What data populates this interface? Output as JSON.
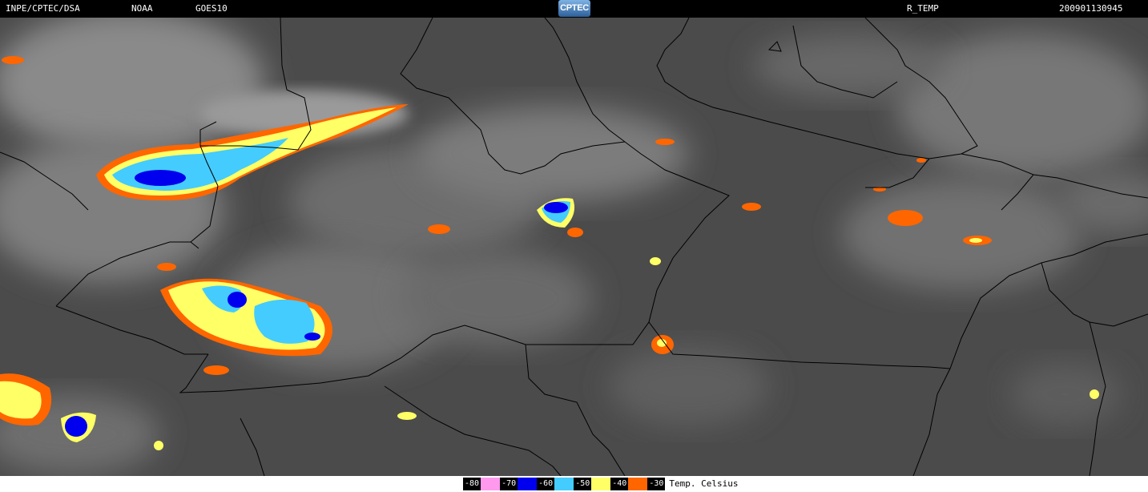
{
  "header": {
    "source": "INPE/CPTEC/DSA",
    "agency": "NOAA",
    "satellite": "GOES10",
    "logo_text": "CPTEC",
    "product": "R_TEMP",
    "timestamp": "200901130945"
  },
  "legend": {
    "items": [
      {
        "label": "-80",
        "color": "#ff99ee"
      },
      {
        "label": "-70",
        "color": "#0000ee"
      },
      {
        "label": "-60",
        "color": "#44ccff"
      },
      {
        "label": "-50",
        "color": "#ffff66"
      },
      {
        "label": "-40",
        "color": "#ff6600"
      },
      {
        "label": "-30",
        "color": ""
      }
    ],
    "unit": "Temp. Celsius"
  },
  "colors": {
    "background": "#4b4b4b",
    "borders": "#000000",
    "text": "#ffffff"
  }
}
